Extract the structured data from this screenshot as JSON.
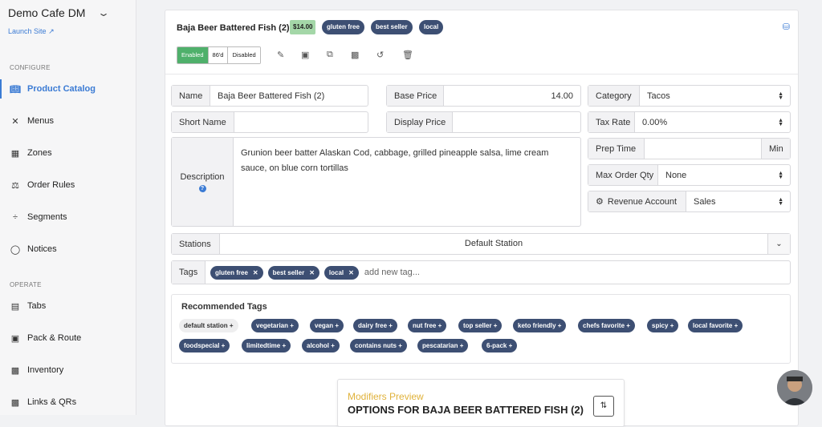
{
  "sidebar": {
    "brand": "Demo Cafe DM",
    "launch": "Launch Site",
    "section_configure": "CONFIGURE",
    "section_operate": "OPERATE",
    "configure_items": [
      {
        "label": "Product Catalog",
        "icon": "book-icon",
        "active": true
      },
      {
        "label": "Menus",
        "icon": "utensils-icon"
      },
      {
        "label": "Zones",
        "icon": "boxes-icon"
      },
      {
        "label": "Order Rules",
        "icon": "balance-scale-icon"
      },
      {
        "label": "Segments",
        "icon": "divide-icon"
      },
      {
        "label": "Notices",
        "icon": "comment-icon"
      }
    ],
    "operate_items": [
      {
        "label": "Tabs",
        "icon": "tabs-icon"
      },
      {
        "label": "Pack & Route",
        "icon": "truck-icon"
      },
      {
        "label": "Inventory",
        "icon": "warehouse-icon"
      },
      {
        "label": "Links & QRs",
        "icon": "qr-code-icon"
      }
    ]
  },
  "product": {
    "title": "Baja Beer Battered Fish (2)",
    "price_badge": "$14.00",
    "tags": [
      "gluten free",
      "best seller",
      "local"
    ],
    "status_options": [
      "Enabled",
      "86'd",
      "Disabled"
    ],
    "status_selected": "Enabled"
  },
  "form": {
    "name_label": "Name",
    "name_value": "Baja Beer Battered Fish (2)",
    "short_name_label": "Short Name",
    "short_name_value": "",
    "description_label": "Description",
    "description_value": "Grunion beer batter Alaskan Cod, cabbage, grilled pineapple salsa, lime cream sauce, on blue corn tortillas",
    "base_price_label": "Base Price",
    "base_price_value": "14.00",
    "display_price_label": "Display Price",
    "display_price_value": "",
    "category_label": "Category",
    "category_value": "Tacos",
    "tax_rate_label": "Tax Rate",
    "tax_rate_value": "0.00%",
    "prep_time_label": "Prep Time",
    "prep_time_value": "",
    "prep_time_unit": "Min",
    "max_order_label": "Max Order Qty",
    "max_order_value": "None",
    "revenue_label": "Revenue Account",
    "revenue_value": "Sales",
    "stations_label": "Stations",
    "stations_value": "Default Station",
    "tags_label": "Tags",
    "tags": [
      "gluten free",
      "best seller",
      "local"
    ],
    "add_tag_placeholder": "add new tag..."
  },
  "recommended": {
    "title": "Recommended Tags",
    "row1": [
      "default station",
      "vegetarian",
      "vegan",
      "dairy free",
      "nut free",
      "top seller",
      "keto friendly",
      "chefs favorite",
      "spicy",
      "local favorite"
    ],
    "row2": [
      "foodspecial",
      "limitedtime",
      "alcohol",
      "contains nuts",
      "pescatarian",
      "6-pack"
    ]
  },
  "modifiers": {
    "title": "Modifiers Preview",
    "subtitle": "OPTIONS FOR BAJA BEER BATTERED FISH (2)"
  },
  "colors": {
    "accent": "#3b7bd4",
    "tag": "#3d4f73",
    "enabled": "#4fb06b",
    "price": "#a4d7a8",
    "modifiers_title": "#e0b23a"
  }
}
